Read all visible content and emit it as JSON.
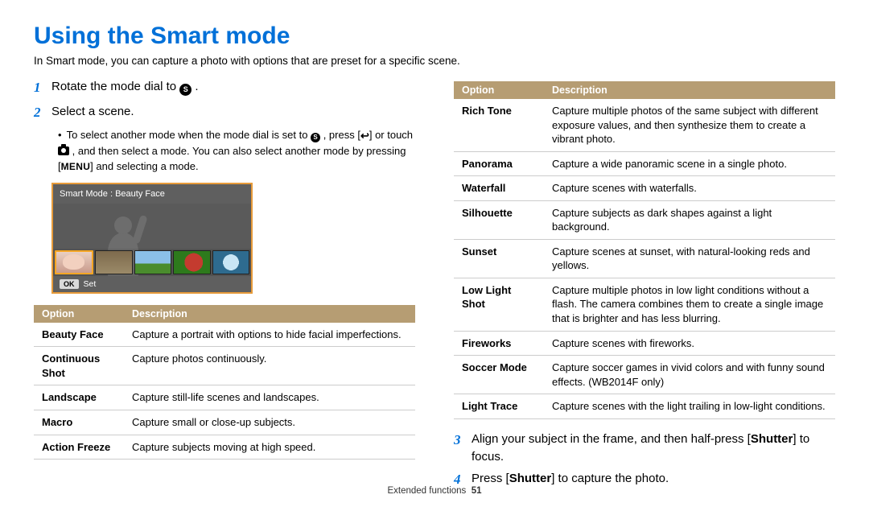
{
  "title": "Using the Smart mode",
  "intro": "In Smart mode, you can capture a photo with options that are preset for a specific scene.",
  "icon_letter": "S",
  "steps": {
    "s1_pre": "Rotate the mode dial to ",
    "s1_post": " .",
    "s2": "Select a scene.",
    "s3_pre": "Align your subject in the frame, and then half-press [",
    "s3_bold": "Shutter",
    "s3_post": "] to focus.",
    "s4_pre": "Press [",
    "s4_bold": "Shutter",
    "s4_post": "] to capture the photo."
  },
  "sub": {
    "pre1": "To select another mode when the mode dial is set to ",
    "pre2": " , press [",
    "pre3": "] or touch ",
    "pre4": " , and then select a mode. You can also select another mode by pressing [",
    "menu_label": "MENU",
    "pre5": "] and selecting a mode."
  },
  "screen": {
    "top": "Smart Mode : Beauty Face",
    "ok": "OK",
    "set": "Set"
  },
  "table_headers": {
    "option": "Option",
    "description": "Description"
  },
  "table_left": [
    {
      "name": "Beauty Face",
      "desc": "Capture a portrait with options to hide facial imperfections."
    },
    {
      "name": "Continuous Shot",
      "desc": "Capture photos continuously."
    },
    {
      "name": "Landscape",
      "desc": "Capture still-life scenes and landscapes."
    },
    {
      "name": "Macro",
      "desc": "Capture small or close-up subjects."
    },
    {
      "name": "Action Freeze",
      "desc": "Capture subjects moving at high speed."
    }
  ],
  "table_right": [
    {
      "name": "Rich Tone",
      "desc": "Capture multiple photos of the same subject with different exposure values, and then synthesize them to create a vibrant photo."
    },
    {
      "name": "Panorama",
      "desc": "Capture a wide panoramic scene in a single photo."
    },
    {
      "name": "Waterfall",
      "desc": "Capture scenes with waterfalls."
    },
    {
      "name": "Silhouette",
      "desc": "Capture subjects as dark shapes against a light background."
    },
    {
      "name": "Sunset",
      "desc": "Capture scenes at sunset, with natural-looking reds and yellows."
    },
    {
      "name": "Low Light Shot",
      "desc": "Capture multiple photos in low light conditions without a flash. The camera combines them to create a single image that is brighter and has less blurring."
    },
    {
      "name": "Fireworks",
      "desc": "Capture scenes with fireworks."
    },
    {
      "name": "Soccer Mode",
      "desc": "Capture soccer games in vivid colors and with funny sound effects. (WB2014F only)"
    },
    {
      "name": "Light Trace",
      "desc": "Capture scenes with the light trailing in low-light conditions."
    }
  ],
  "footer": {
    "section": "Extended functions",
    "page": "51"
  }
}
